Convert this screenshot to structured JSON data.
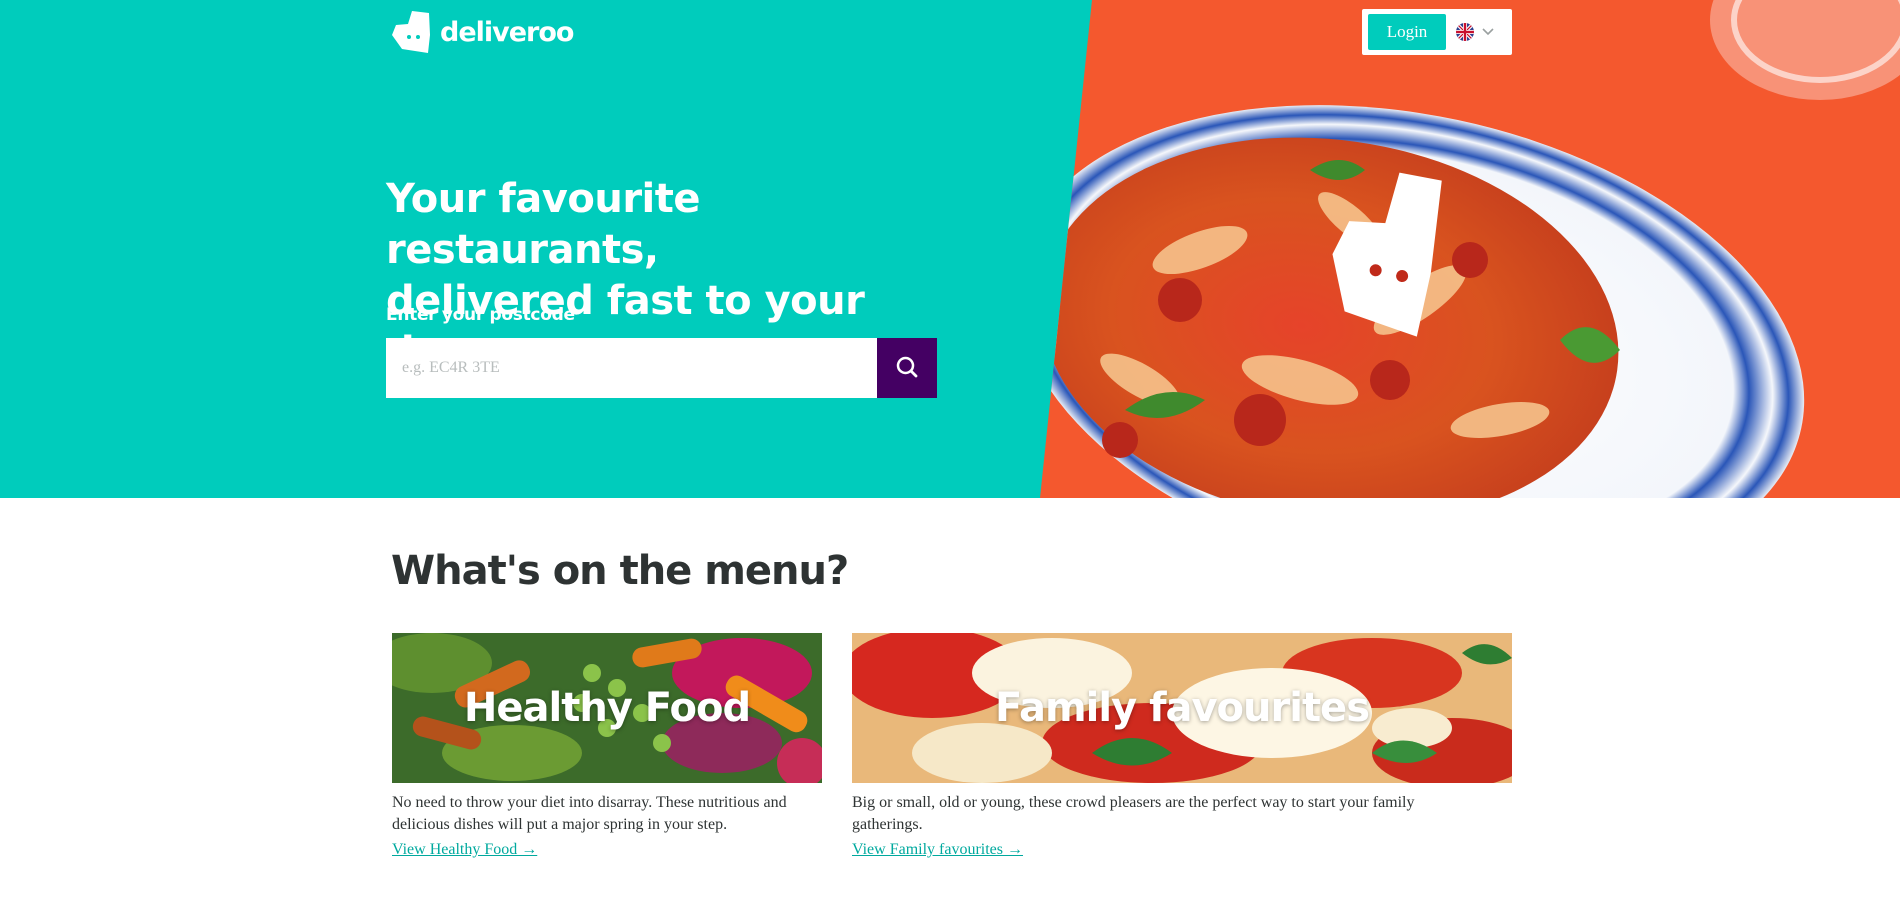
{
  "brand": {
    "name": "deliveroo",
    "accent_color": "#00ccbc",
    "secondary_color": "#440063"
  },
  "header": {
    "login_label": "Login",
    "language_flag": "uk-flag-icon",
    "language_menu_icon": "chevron-down-icon"
  },
  "hero": {
    "headline_line1": "Your favourite restaurants,",
    "headline_line2": "delivered fast to your door.",
    "postcode_label": "Enter your postcode",
    "postcode_placeholder": "e.g. EC4R 3TE",
    "postcode_value": "",
    "search_icon": "search-icon"
  },
  "menu_section": {
    "title": "What's on the menu?",
    "cards": [
      {
        "title": "Healthy Food",
        "description": "No need to throw your diet into disarray. These nutritious and delicious dishes will put a major spring in your step.",
        "link": "View Healthy Food →"
      },
      {
        "title": "Family favourites",
        "description": "Big or small, old or young, these crowd pleasers are the perfect way to start your family gatherings.",
        "link": "View Family favourites →"
      }
    ]
  }
}
